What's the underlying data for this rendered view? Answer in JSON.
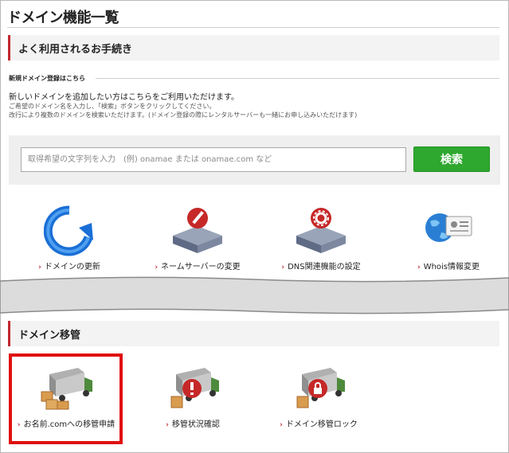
{
  "page": {
    "title": "ドメイン機能一覧"
  },
  "section_frequent": {
    "title": "よく利用されるお手続き"
  },
  "new_domain": {
    "sub_label": "新規ドメイン登録はこちら",
    "lead": "新しいドメインを追加したい方はこちらをご利用いただけます。",
    "note1": "ご希望のドメイン名を入力し、「検索」ボタンをクリックしてください。",
    "note2": "改行により複数のドメインを検索いただけます。(ドメイン登録の際にレンタルサーバーも一緒にお申し込みいただけます)"
  },
  "search": {
    "placeholder": "取得希望の文字列を入力　(例) onamae または onamae.com など",
    "button_label": "検索"
  },
  "frequent_items": [
    {
      "label": "ドメインの更新",
      "icon": "renew-arrow-icon"
    },
    {
      "label": "ネームサーバーの変更",
      "icon": "server-edit-icon"
    },
    {
      "label": "DNS関連機能の設定",
      "icon": "server-gear-icon"
    },
    {
      "label": "Whois情報変更",
      "icon": "globe-id-card-icon"
    }
  ],
  "section_transfer": {
    "title": "ドメイン移管"
  },
  "transfer_items": [
    {
      "label": "お名前.comへの移管申請",
      "icon": "truck-boxes-icon"
    },
    {
      "label": "移管状況確認",
      "icon": "truck-alert-icon"
    },
    {
      "label": "ドメイン移管ロック",
      "icon": "truck-lock-icon"
    }
  ],
  "arrow_glyph": "›",
  "colors": {
    "accent_red": "#c1272d",
    "button_green": "#2ea82e",
    "highlight": "#e01010"
  }
}
